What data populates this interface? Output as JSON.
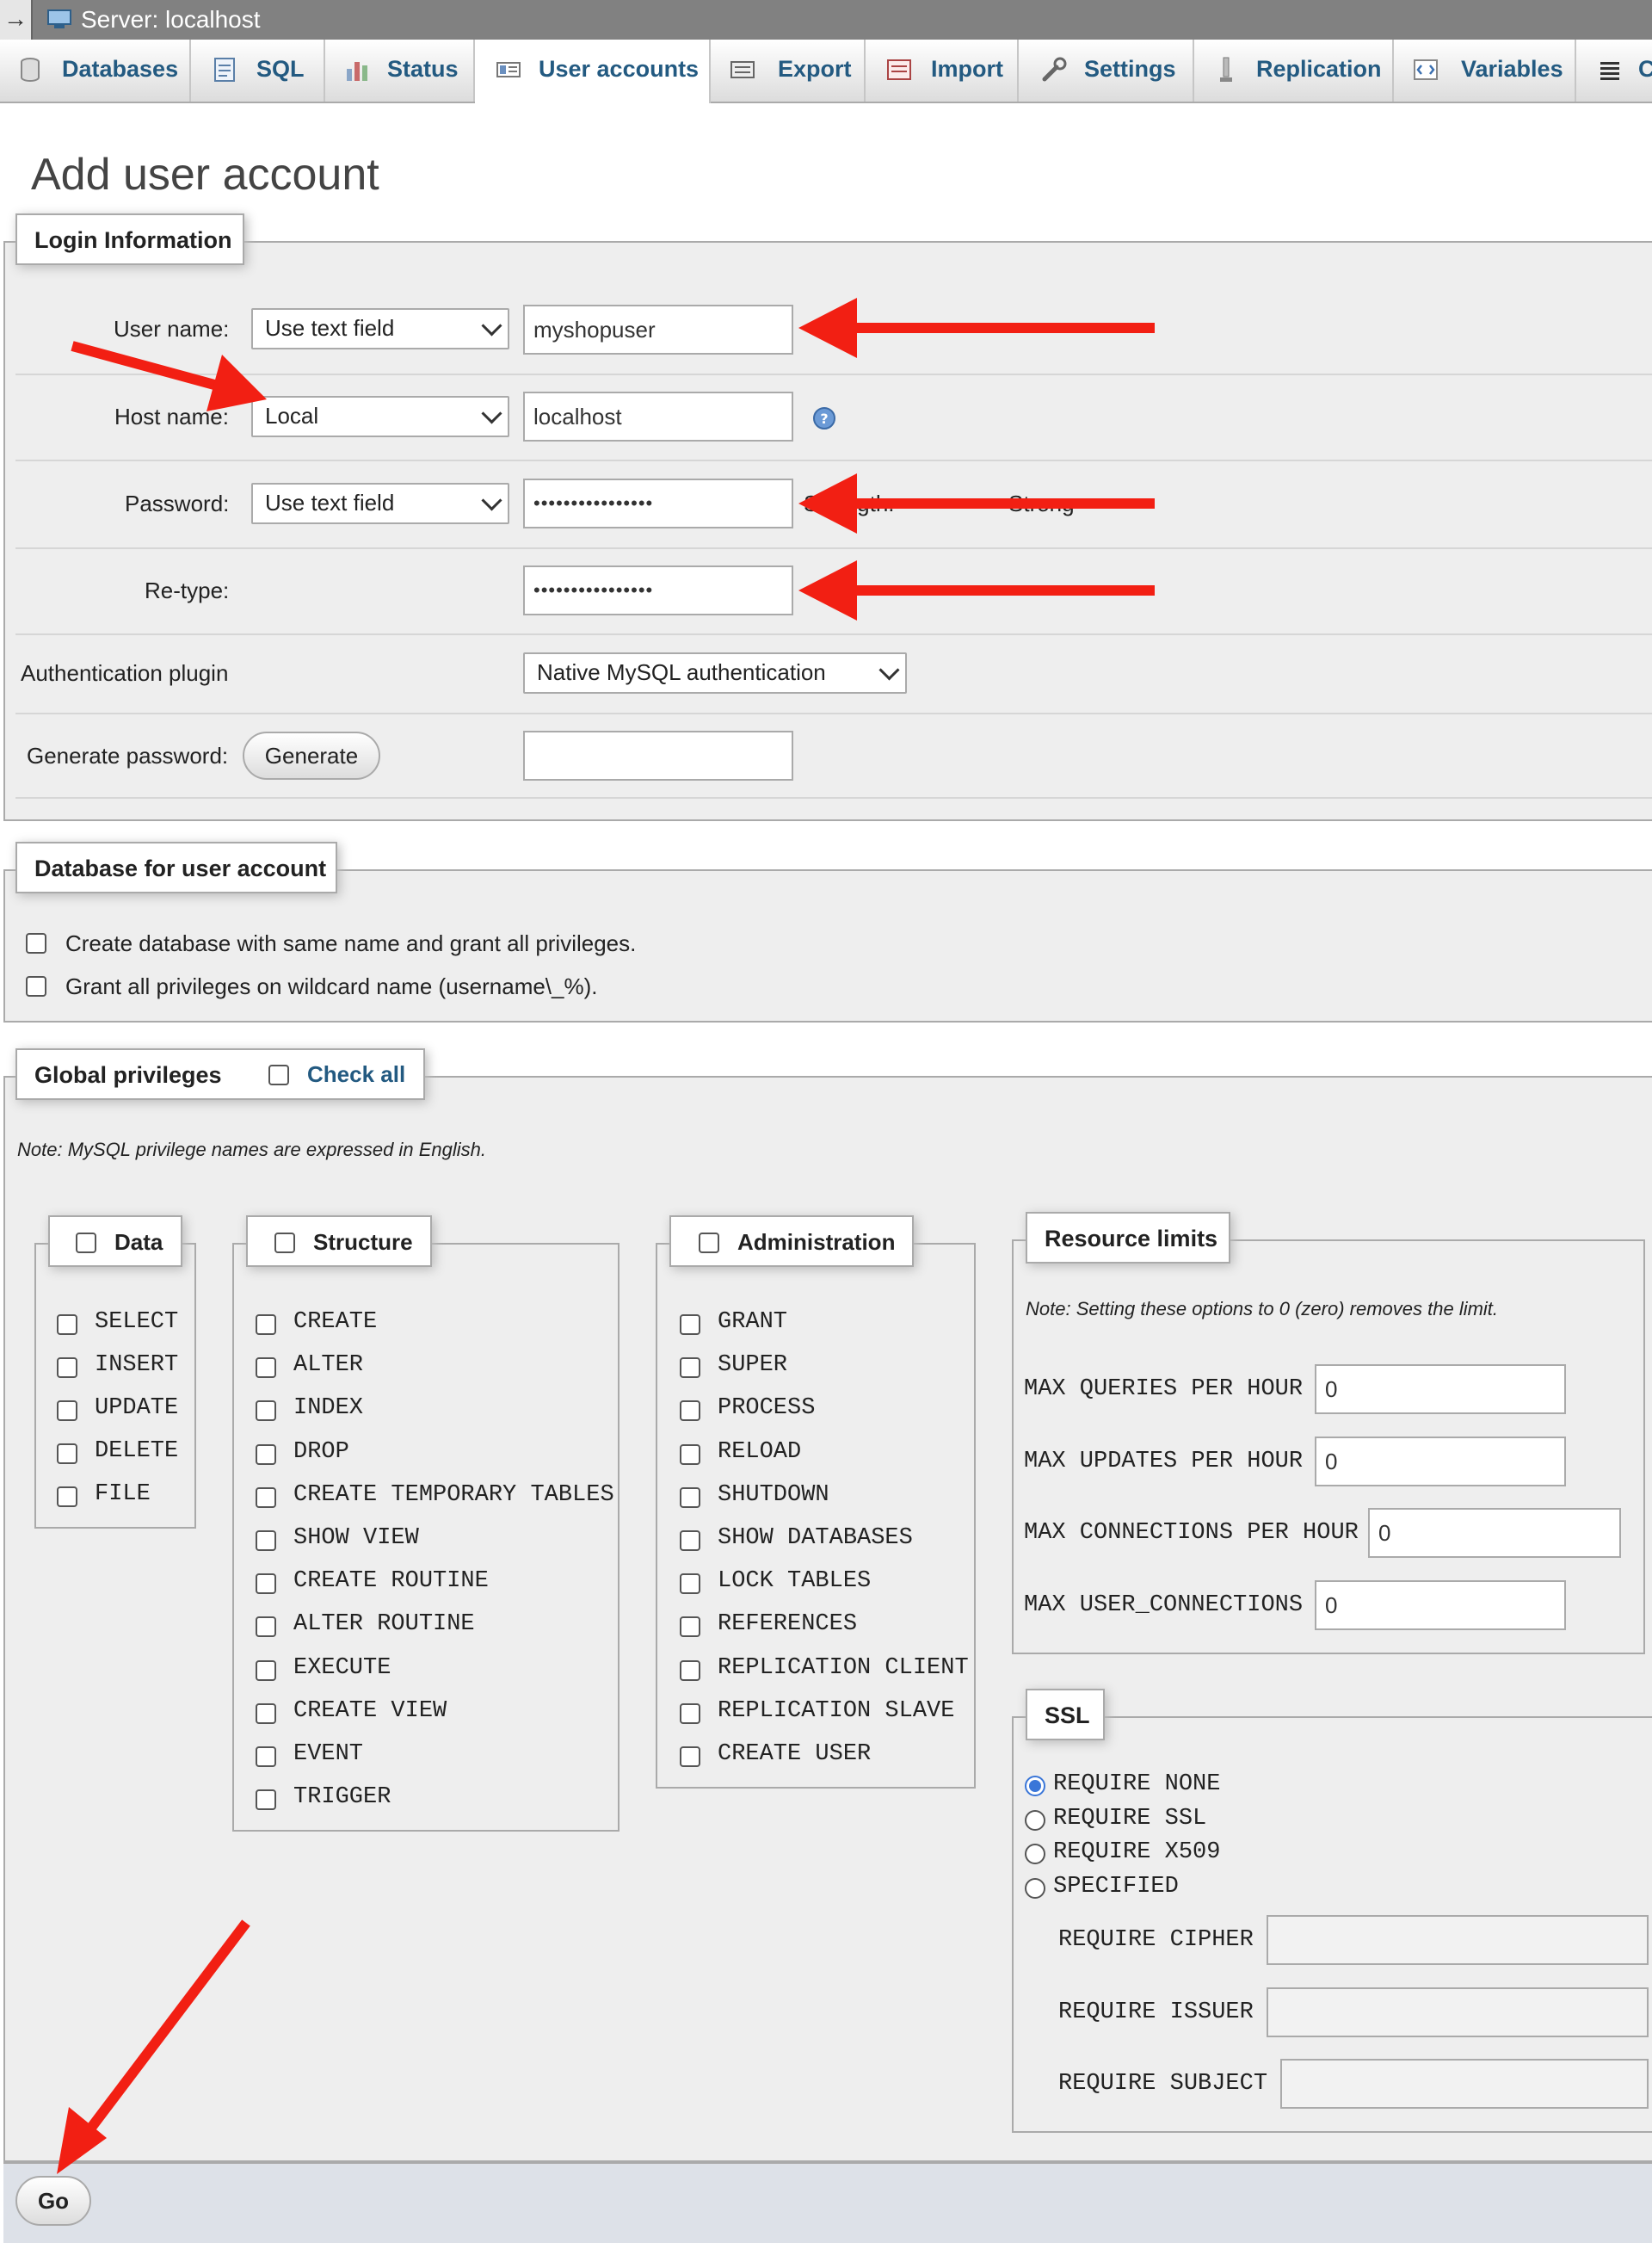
{
  "server_bar": {
    "label": "Server: localhost",
    "collapse_glyph": "→"
  },
  "tabs": [
    {
      "label": "Databases",
      "icon": "database-icon"
    },
    {
      "label": "SQL",
      "icon": "sql-icon"
    },
    {
      "label": "Status",
      "icon": "status-icon"
    },
    {
      "label": "User accounts",
      "icon": "user-accounts-icon",
      "active": true
    },
    {
      "label": "Export",
      "icon": "export-icon"
    },
    {
      "label": "Import",
      "icon": "import-icon"
    },
    {
      "label": "Settings",
      "icon": "settings-icon"
    },
    {
      "label": "Replication",
      "icon": "replication-icon"
    },
    {
      "label": "Variables",
      "icon": "variables-icon"
    },
    {
      "label": "C",
      "icon": "charsets-icon"
    }
  ],
  "page_title": "Add user account",
  "login": {
    "legend": "Login Information",
    "user_name_label": "User name:",
    "user_name_mode": "Use text field",
    "user_name_value": "myshopuser",
    "host_name_label": "Host name:",
    "host_name_mode": "Local",
    "host_name_value": "localhost",
    "password_label": "Password:",
    "password_mode": "Use text field",
    "password_value": "••••••••••••••••",
    "strength_label": "Strength:",
    "strength_value": "Strong",
    "retype_label": "Re-type:",
    "retype_value": "••••••••••••••••",
    "auth_plugin_label": "Authentication plugin",
    "auth_plugin_value": "Native MySQL authentication",
    "generate_label": "Generate password:",
    "generate_button": "Generate",
    "generated_value": ""
  },
  "database": {
    "legend": "Database for user account",
    "option1": "Create database with same name and grant all privileges.",
    "option2": "Grant all privileges on wildcard name (username\\_%)."
  },
  "global": {
    "legend": "Global privileges",
    "check_all": "Check all",
    "note": "Note: MySQL privilege names are expressed in English."
  },
  "data_group": {
    "legend": "Data",
    "items": [
      "SELECT",
      "INSERT",
      "UPDATE",
      "DELETE",
      "FILE"
    ]
  },
  "structure_group": {
    "legend": "Structure",
    "items": [
      "CREATE",
      "ALTER",
      "INDEX",
      "DROP",
      "CREATE TEMPORARY TABLES",
      "SHOW VIEW",
      "CREATE ROUTINE",
      "ALTER ROUTINE",
      "EXECUTE",
      "CREATE VIEW",
      "EVENT",
      "TRIGGER"
    ]
  },
  "admin_group": {
    "legend": "Administration",
    "items": [
      "GRANT",
      "SUPER",
      "PROCESS",
      "RELOAD",
      "SHUTDOWN",
      "SHOW DATABASES",
      "LOCK TABLES",
      "REFERENCES",
      "REPLICATION CLIENT",
      "REPLICATION SLAVE",
      "CREATE USER"
    ]
  },
  "resources": {
    "legend": "Resource limits",
    "note": "Note: Setting these options to 0 (zero) removes the limit.",
    "limits": [
      {
        "label": "MAX QUERIES PER HOUR",
        "value": "0"
      },
      {
        "label": "MAX UPDATES PER HOUR",
        "value": "0"
      },
      {
        "label": "MAX CONNECTIONS PER HOUR",
        "value": "0"
      },
      {
        "label": "MAX USER_CONNECTIONS",
        "value": "0"
      }
    ]
  },
  "ssl": {
    "legend": "SSL",
    "options": [
      "REQUIRE NONE",
      "REQUIRE SSL",
      "REQUIRE X509",
      "SPECIFIED"
    ],
    "selected": "REQUIRE NONE",
    "fields": [
      "REQUIRE CIPHER",
      "REQUIRE ISSUER",
      "REQUIRE SUBJECT"
    ]
  },
  "go_button": "Go",
  "colors": {
    "tab_text": "#235a81",
    "annotation_arrow": "#f21f13",
    "radio_selected": "#3a76d8"
  }
}
